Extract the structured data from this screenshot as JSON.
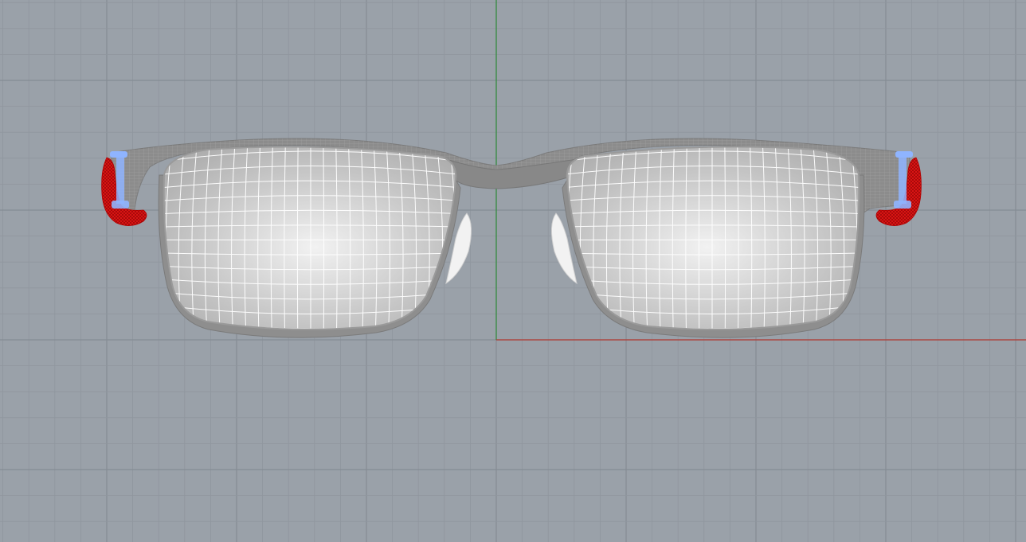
{
  "viewport": {
    "label": "",
    "background": "#9aa1a9",
    "grid_minor_color": "#8f969e",
    "grid_major_color": "#858c94",
    "axis_y_color": "#2e8b3a",
    "axis_x_color": "#b23a32"
  },
  "model": {
    "frame_color": "#8a8a8a",
    "frame_wire_color": "#a9a9a9",
    "lens_wire_color": "#ffffff",
    "lens_fill_color": "#cfcfcf",
    "hinge_color": "#e01818",
    "hinge_cap_color": "#8fb4ff",
    "nose_pad_color": "#f2f2f2"
  }
}
